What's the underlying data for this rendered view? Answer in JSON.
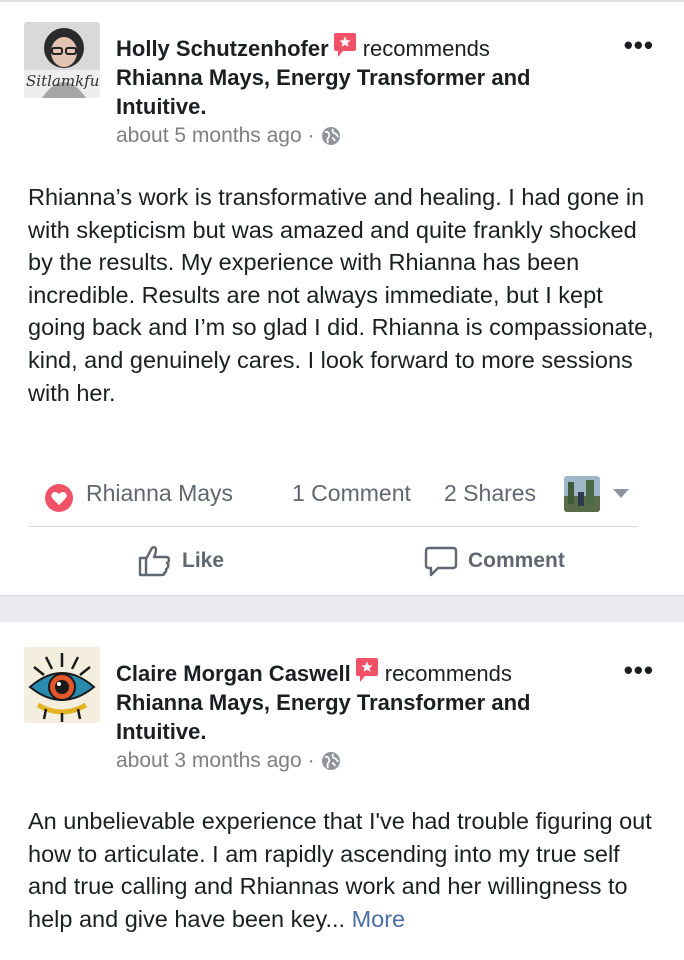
{
  "posts": [
    {
      "author": "Holly Schutzenhofer",
      "recommends": "recommends",
      "page": "Rhianna Mays, Energy Transformer and Intuitive.",
      "time": "about 5 months ago",
      "dot": "·",
      "body": "Rhianna’s work is transformative and healing. I had gone in with skepticism but was amazed and quite frankly shocked by the results. My experience with Rhianna has been incredible. Results are not always immediate, but I kept going back and I’m so glad I did. Rhianna is compassionate, kind, and genuinely cares. I look forward to more sessions with her.",
      "reaction_name": "Rhianna Mays",
      "comments": "1 Comment",
      "shares": "2 Shares",
      "like_label": "Like",
      "comment_label": "Comment",
      "avatar_text": "Sitlamkful"
    },
    {
      "author": "Claire Morgan Caswell",
      "recommends": "recommends",
      "page": "Rhianna Mays, Energy Transformer and Intuitive.",
      "time": "about 3 months ago",
      "dot": "·",
      "body": "An unbelievable experience that I've had trouble figuring out how to articulate. I am rapidly ascending into my true self and true calling and Rhiannas work and her willingness to help and give have been key...",
      "more": "More"
    }
  ],
  "colors": {
    "recommend_red": "#f25268",
    "link_blue": "#4b6ea5",
    "muted": "#606770"
  }
}
